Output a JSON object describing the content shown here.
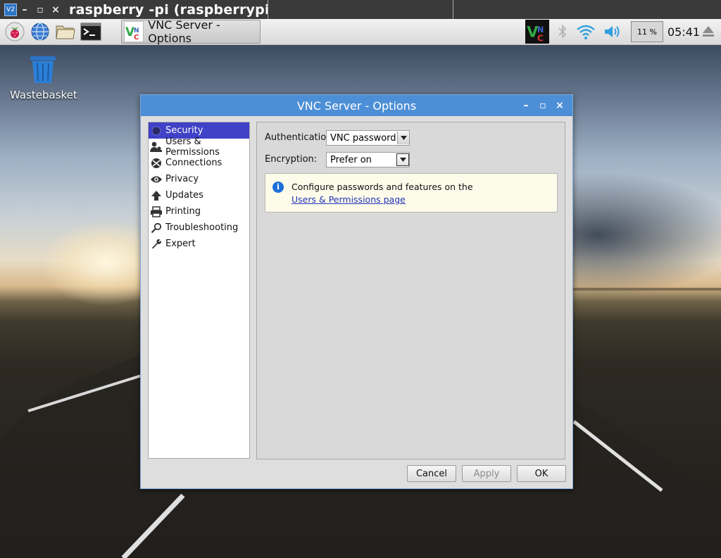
{
  "viewer": {
    "title": "raspberry -pi (raspberrypi) - VNC Viewer",
    "icon": "V2",
    "controls": [
      "–",
      "▫",
      "×"
    ]
  },
  "panel": {
    "launchers": [
      "raspberry-menu-icon",
      "web-browser-icon",
      "file-manager-icon",
      "terminal-icon"
    ],
    "taskbar_item": "VNC Server - Options",
    "tray": {
      "cpu": "11 %",
      "clock": "05:41"
    }
  },
  "desktop": {
    "wastebasket_label": "Wastebasket"
  },
  "dialog": {
    "title": "VNC Server - Options",
    "controls": [
      "–",
      "▫",
      "×"
    ],
    "sidebar": [
      {
        "label": "Security",
        "icon": "shield-icon",
        "selected": true
      },
      {
        "label": "Users & Permissions",
        "icon": "users-icon",
        "selected": false
      },
      {
        "label": "Connections",
        "icon": "connections-icon",
        "selected": false
      },
      {
        "label": "Privacy",
        "icon": "eye-icon",
        "selected": false
      },
      {
        "label": "Updates",
        "icon": "up-arrow-icon",
        "selected": false
      },
      {
        "label": "Printing",
        "icon": "printer-icon",
        "selected": false
      },
      {
        "label": "Troubleshooting",
        "icon": "magnifier-icon",
        "selected": false
      },
      {
        "label": "Expert",
        "icon": "wrench-icon",
        "selected": false
      }
    ],
    "security": {
      "authentication_label": "Authentication:",
      "authentication_value": "VNC password",
      "encryption_label": "Encryption:",
      "encryption_value": "Prefer on",
      "info_text": "Configure passwords and features on the",
      "info_link": "Users & Permissions page"
    },
    "buttons": {
      "cancel": "Cancel",
      "apply": "Apply",
      "ok": "OK"
    }
  },
  "colors": {
    "dialog_title_bar": "#4d8fd6",
    "selected_item": "#3f41c7",
    "info_background": "#fdfbe9"
  }
}
